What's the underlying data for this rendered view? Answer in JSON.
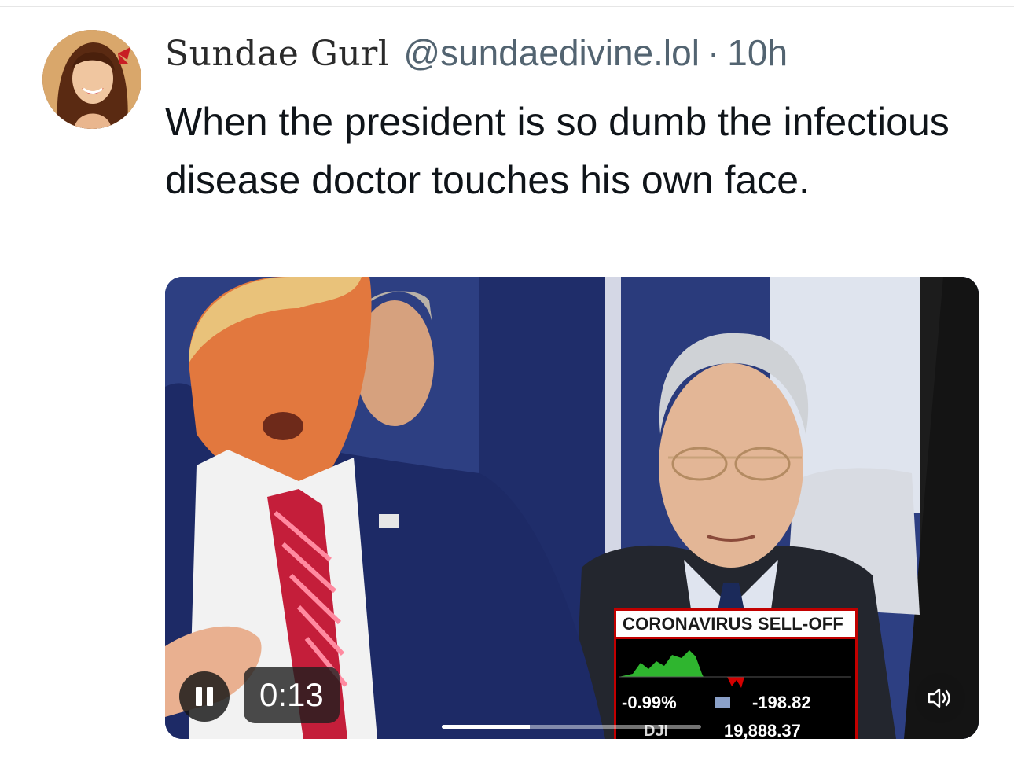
{
  "tweet": {
    "author": {
      "display_name": "Sundae Gurl",
      "handle": "@sundaedivine.lol",
      "separator": "·",
      "timestamp": "10h",
      "avatar_icon": "avatar-portrait"
    },
    "text": "When the president is so dumb the infectious disease doctor touches his own face."
  },
  "video": {
    "elapsed": "0:13",
    "progress_fraction": 0.34,
    "pause_icon": "pause-icon",
    "volume_icon": "speaker-icon",
    "ticker": {
      "title": "CORONAVIRUS SELL-OFF",
      "percent_change": "-0.99%",
      "point_change": "-198.82",
      "index_label": "DJI",
      "index_value": "19,888.37",
      "colors": {
        "up": "#2fb52f",
        "down": "#d40000",
        "border": "#c20000"
      }
    }
  }
}
